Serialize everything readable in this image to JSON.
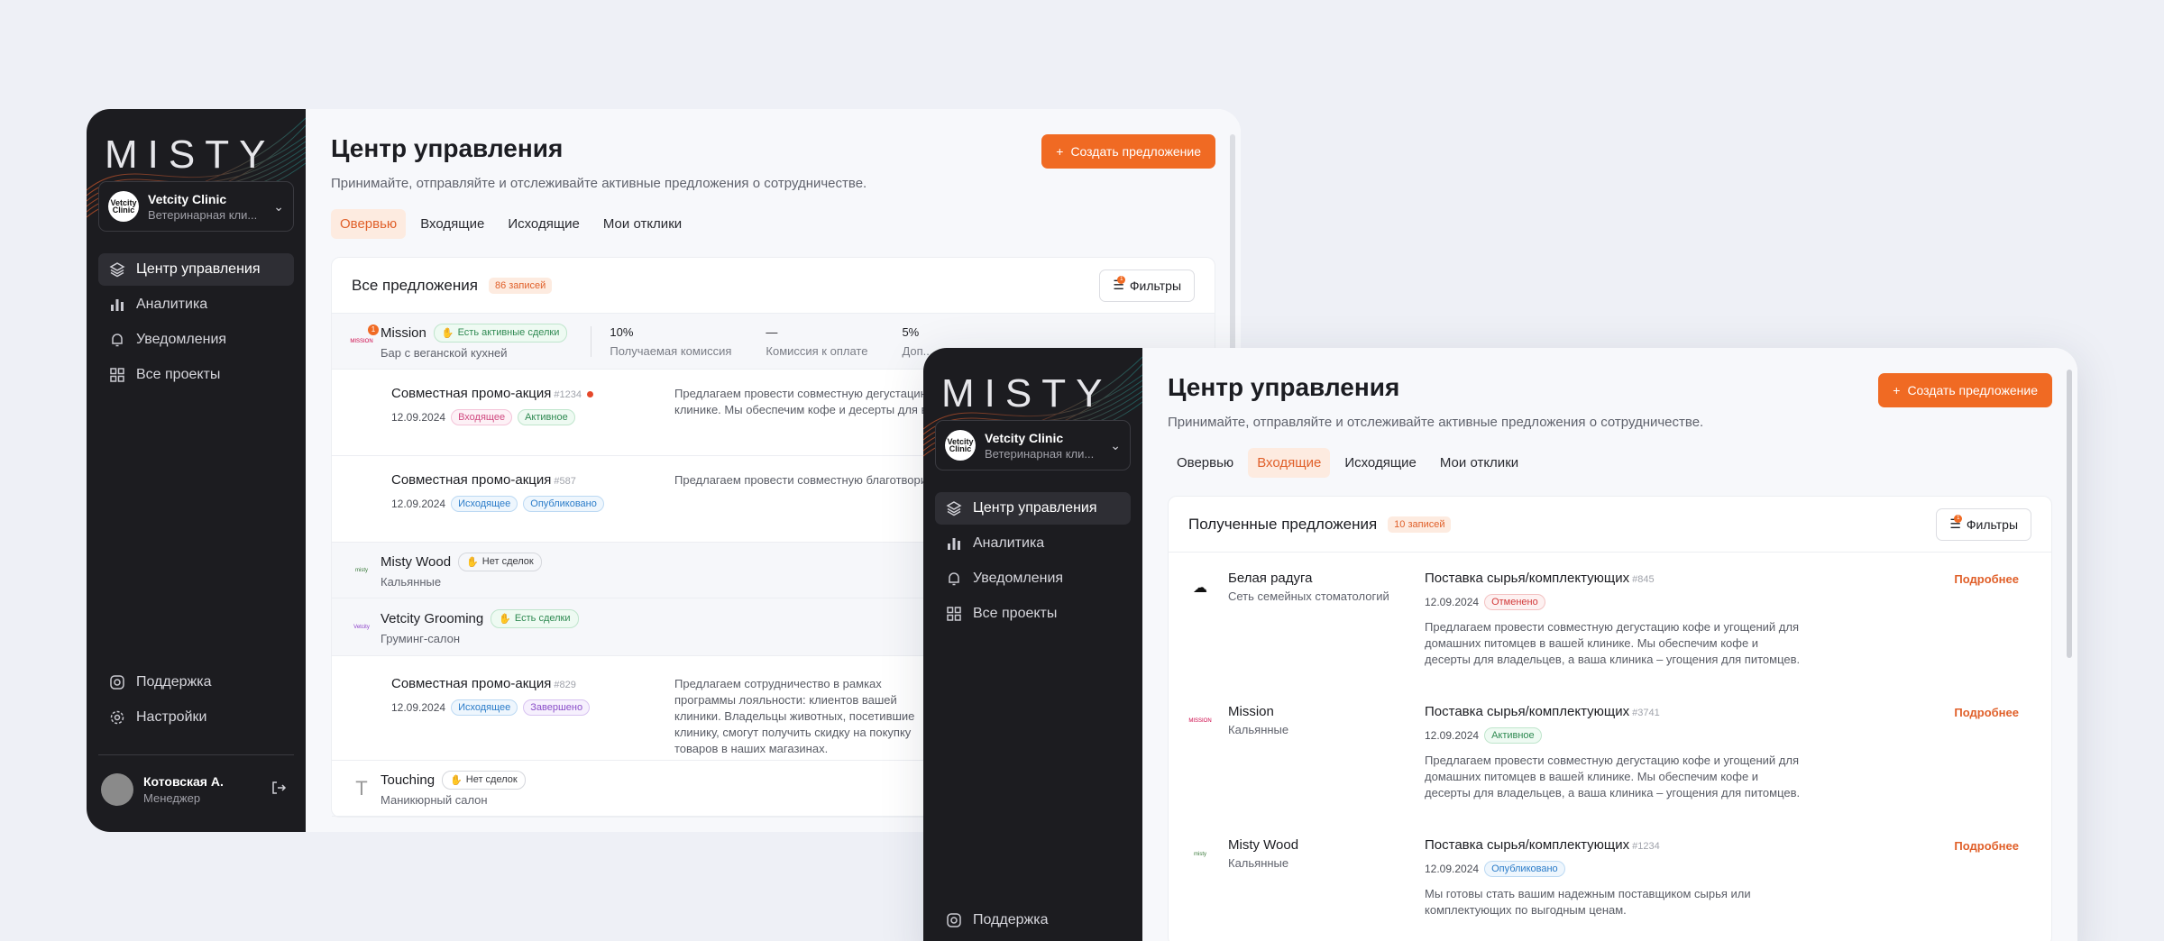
{
  "brand": "MISTY",
  "org": {
    "name": "Vetcity Clinic",
    "type": "Ветеринарная кли...",
    "logo": "Vetcity Clinic"
  },
  "nav": [
    "Центр управления",
    "Аналитика",
    "Уведомления",
    "Все проекты"
  ],
  "nav_bottom": [
    "Поддержка",
    "Настройки"
  ],
  "user": {
    "name": "Котовская А.",
    "role": "Менеджер"
  },
  "page": {
    "title": "Центр управления",
    "subtitle": "Принимайте, отправляйте и отслеживайте активные предложения о сотрудничестве.",
    "create": "Создать предложение"
  },
  "tabs": [
    "Овервью",
    "Входящие",
    "Исходящие",
    "Мои отклики"
  ],
  "filters": {
    "label": "Фильтры",
    "badge": "1"
  },
  "w1": {
    "card_title": "Все предложения",
    "count": "86 записей",
    "g1": {
      "name": "Mission",
      "sub": "Бар с веганской кухней",
      "badge": "Есть активные сделки",
      "notif": "1",
      "stats": [
        {
          "v": "10%",
          "l": "Получаемая комиссия"
        },
        {
          "v": "—",
          "l": "Комиссия к оплате"
        },
        {
          "v": "5%",
          "l": "Доп..."
        }
      ]
    },
    "r1": {
      "title": "Совместная промо-акция",
      "id": "#1234",
      "date": "12.09.2024",
      "t1": "Входящее",
      "t2": "Активное",
      "desc": "Предлагаем провести совместную дегустацию кофе и угощений для домашних питомцев в вашей клинике. Мы обеспечим кофе и десерты для владельцев, а ваша клиника – угощения для питомцев."
    },
    "r2": {
      "title": "Совместная промо-акция",
      "id": "#587",
      "date": "12.09.2024",
      "t1": "Исходящее",
      "t2": "Опубликовано",
      "desc": "Предлагаем провести совместную благотворительную акцию по сбору игрушек для животных в приютах."
    },
    "g2": {
      "name": "Misty Wood",
      "sub": "Кальянные",
      "badge": "Нет сделок"
    },
    "g3": {
      "name": "Vetcity Grooming",
      "sub": "Груминг-салон",
      "badge": "Есть сделки"
    },
    "r3": {
      "title": "Совместная промо-акция",
      "id": "#829",
      "date": "12.09.2024",
      "t1": "Исходящее",
      "t2": "Завершено",
      "desc": "Предлагаем сотрудничество в рамках программы лояльности: клиентов вашей клиники. Владельцы животных, посетившие клинику, смогут получить скидку на покупку товаров в наших магазинах."
    },
    "g4": {
      "name": "Touching",
      "sub": "Маникюрный салон",
      "badge": "Нет сделок"
    }
  },
  "w2": {
    "card_title": "Полученные предложения",
    "count": "10 записей",
    "more": "Подробнее",
    "rows": [
      {
        "name": "Белая радуга",
        "sub": "Сеть семейных стоматологий",
        "title": "Поставка сырья/комплектующих",
        "id": "#845",
        "date": "12.09.2024",
        "tag": "Отменено",
        "desc": "Предлагаем провести совместную дегустацию кофе и угощений для домашних питомцев в вашей клинике. Мы обеспечим кофе и десерты для владельцев, а ваша клиника – угощения для питомцев."
      },
      {
        "name": "Mission",
        "sub": "Кальянные",
        "title": "Поставка сырья/комплектующих",
        "id": "#3741",
        "date": "12.09.2024",
        "tag": "Активное",
        "desc": "Предлагаем провести совместную дегустацию кофе и угощений для домашних питомцев в вашей клинике. Мы обеспечим кофе и десерты для владельцев, а ваша клиника – угощения для питомцев."
      },
      {
        "name": "Misty Wood",
        "sub": "Кальянные",
        "title": "Поставка сырья/комплектующих",
        "id": "#1234",
        "date": "12.09.2024",
        "tag": "Опубликовано",
        "desc": "Мы готовы стать вашим надежным поставщиком сырья или комплектующих по выгодным ценам."
      }
    ]
  }
}
